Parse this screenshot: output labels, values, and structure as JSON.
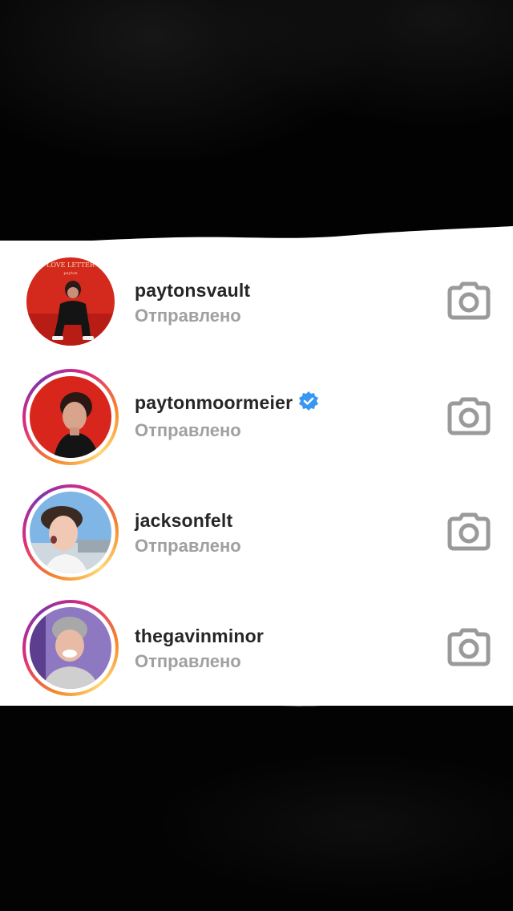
{
  "screen": {
    "colors": {
      "background": "#000000",
      "panel": "#ffffff",
      "username": "#262626",
      "status": "#a0a0a0",
      "verified": "#3897f0",
      "icon": "#9a9a9a"
    }
  },
  "list": {
    "items": [
      {
        "username": "paytonsvault",
        "status": "Отправлено",
        "verified": false,
        "story_ring": false,
        "avatar_text": "LOVE LETTER",
        "avatar_subtext": "payton",
        "camera_icon": "camera-icon"
      },
      {
        "username": "paytonmoormeier",
        "status": "Отправлено",
        "verified": true,
        "story_ring": true,
        "camera_icon": "camera-icon"
      },
      {
        "username": "jacksonfelt",
        "status": "Отправлено",
        "verified": false,
        "story_ring": true,
        "camera_icon": "camera-icon"
      },
      {
        "username": "thegavinminor",
        "status": "Отправлено",
        "verified": false,
        "story_ring": true,
        "camera_icon": "camera-icon"
      }
    ]
  }
}
